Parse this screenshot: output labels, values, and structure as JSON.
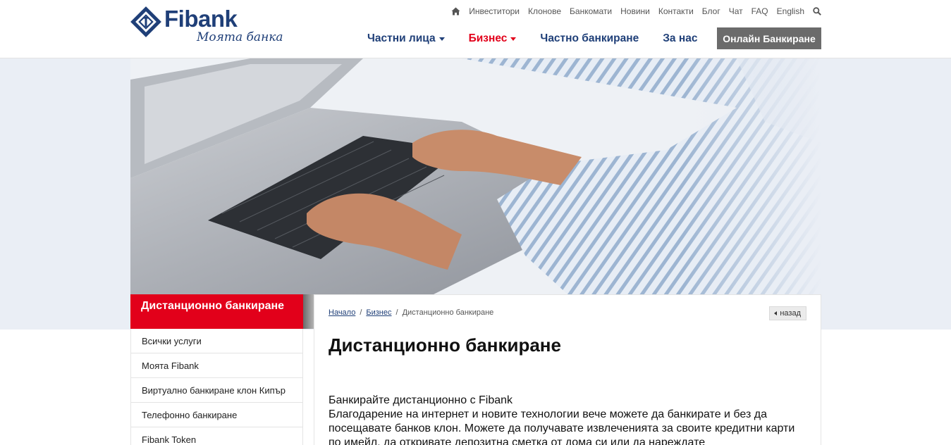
{
  "header": {
    "logo_word": "Fibank",
    "logo_slogan": "Моята банка",
    "util_links": [
      "Инвеститори",
      "Клонове",
      "Банкомати",
      "Новини",
      "Контакти",
      "Блог",
      "Чат",
      "FAQ",
      "English"
    ],
    "nav": [
      {
        "label": "Частни лица",
        "dropdown": true,
        "color": "#1f3f78"
      },
      {
        "label": "Бизнес",
        "dropdown": true,
        "color": "#e2001a"
      },
      {
        "label": "Частно банкиране",
        "dropdown": false,
        "color": "#1f3f78"
      },
      {
        "label": "За нас",
        "dropdown": false,
        "color": "#1f3f78"
      }
    ],
    "online_button": "Онлайн Банкиране"
  },
  "sidebar": {
    "title": "Дистанционно банкиране",
    "items": [
      "Всички услуги",
      "Моята Fibank",
      "Виртуално банкиране клон Кипър",
      "Телефонно банкиране",
      "Fibank Token"
    ]
  },
  "breadcrumb": {
    "home": "Начало",
    "section": "Бизнес",
    "current": "Дистанционно банкиране"
  },
  "back_label": "назад",
  "page_title": "Дистанционно банкиране",
  "content": {
    "lead": "Банкирайте дистанционно с Fibank",
    "body": "Благодарение на интернет и новите технологии вече можете да банкирате и без да посещавате банков клон. Можете да получавате извлеченията за своите кредитни карти по имейл, да откривате депозитна сметка от дома си или да нареждате"
  },
  "colors": {
    "brand_blue": "#1f3f78",
    "brand_red": "#e2001a",
    "button_gray": "#6b6b6b"
  },
  "icons": [
    "home-icon",
    "search-icon",
    "fibank-logo-icon",
    "back-arrow-icon"
  ]
}
